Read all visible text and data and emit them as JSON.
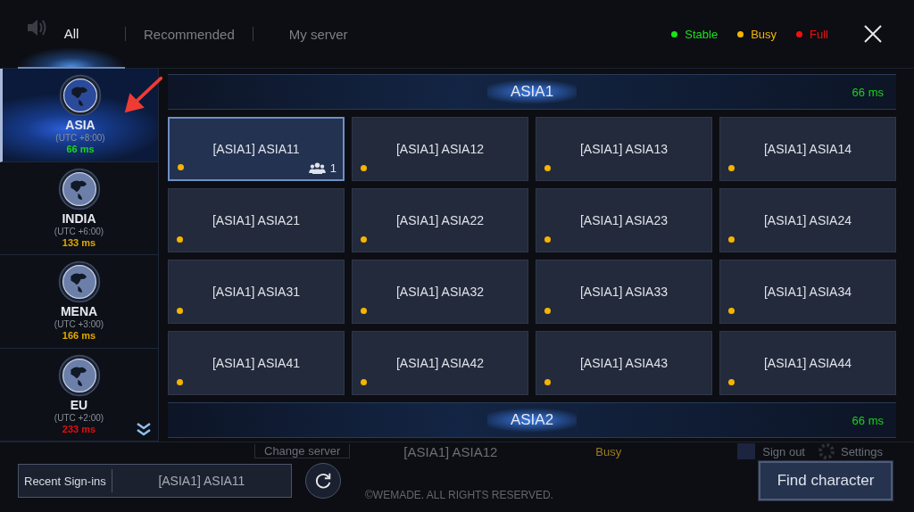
{
  "tabs": [
    {
      "label": "All",
      "selected": true
    },
    {
      "label": "Recommended",
      "selected": false
    },
    {
      "label": "My server",
      "selected": false
    }
  ],
  "legend": [
    {
      "label": "Stable",
      "color": "#19e619"
    },
    {
      "label": "Busy",
      "color": "#f5b400"
    },
    {
      "label": "Full",
      "color": "#f01010"
    }
  ],
  "regions": [
    {
      "name": "ASIA",
      "utc": "(UTC +8:00)",
      "ping": "66 ms",
      "color": "#19d419",
      "selected": true
    },
    {
      "name": "INDIA",
      "utc": "(UTC +6:00)",
      "ping": "133 ms",
      "color": "#e0a800",
      "selected": false
    },
    {
      "name": "MENA",
      "utc": "(UTC +3:00)",
      "ping": "166 ms",
      "color": "#e0a800",
      "selected": false
    },
    {
      "name": "EU",
      "utc": "(UTC +2:00)",
      "ping": "233 ms",
      "color": "#e01010",
      "selected": false
    }
  ],
  "sections": [
    {
      "title": "ASIA1",
      "ping": "66 ms",
      "servers": [
        {
          "name": "[ASIA1] ASIA11",
          "color": "#f5b400",
          "selected": true,
          "characters": "1"
        },
        {
          "name": "[ASIA1] ASIA12",
          "color": "#f5b400",
          "selected": false
        },
        {
          "name": "[ASIA1] ASIA13",
          "color": "#f5b400",
          "selected": false
        },
        {
          "name": "[ASIA1] ASIA14",
          "color": "#f5b400",
          "selected": false
        },
        {
          "name": "[ASIA1] ASIA21",
          "color": "#f5b400",
          "selected": false
        },
        {
          "name": "[ASIA1] ASIA22",
          "color": "#f5b400",
          "selected": false
        },
        {
          "name": "[ASIA1] ASIA23",
          "color": "#f5b400",
          "selected": false
        },
        {
          "name": "[ASIA1] ASIA24",
          "color": "#f5b400",
          "selected": false
        },
        {
          "name": "[ASIA1] ASIA31",
          "color": "#f5b400",
          "selected": false
        },
        {
          "name": "[ASIA1] ASIA32",
          "color": "#f5b400",
          "selected": false
        },
        {
          "name": "[ASIA1] ASIA33",
          "color": "#f5b400",
          "selected": false
        },
        {
          "name": "[ASIA1] ASIA34",
          "color": "#f5b400",
          "selected": false
        },
        {
          "name": "[ASIA1] ASIA41",
          "color": "#f5b400",
          "selected": false
        },
        {
          "name": "[ASIA1] ASIA42",
          "color": "#f5b400",
          "selected": false
        },
        {
          "name": "[ASIA1] ASIA43",
          "color": "#f5b400",
          "selected": false
        },
        {
          "name": "[ASIA1] ASIA44",
          "color": "#f5b400",
          "selected": false
        }
      ]
    },
    {
      "title": "ASIA2",
      "ping": "66 ms"
    }
  ],
  "background": {
    "change_server": "Change server",
    "server": "[ASIA1] ASIA12",
    "status": "Busy",
    "sign_out": "Sign out",
    "settings": "Settings",
    "copyright": "©WEMADE. ALL RIGHTS RESERVED."
  },
  "recent": {
    "label": "Recent Sign-ins",
    "value": "[ASIA1] ASIA11"
  },
  "find_button": "Find character"
}
